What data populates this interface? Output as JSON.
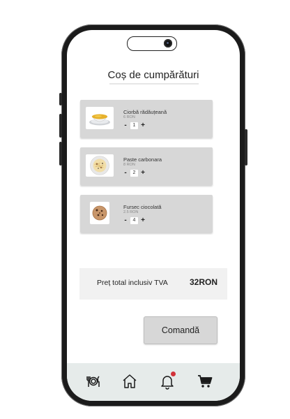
{
  "page": {
    "title": "Coș de cumpărături"
  },
  "cart": {
    "items": [
      {
        "name": "Ciorbă rădăuțeană",
        "price": "6 RON",
        "quantity": "1",
        "icon": "soup-bowl-image"
      },
      {
        "name": "Paste carbonara",
        "price": "8 RON",
        "quantity": "2",
        "icon": "pasta-plate-image"
      },
      {
        "name": "Fursec ciocolată",
        "price": "2.5 RON",
        "quantity": "4",
        "icon": "cookie-image"
      }
    ],
    "decrement_label": "-",
    "increment_label": "+"
  },
  "total": {
    "label": "Preț total inclusiv TVA",
    "value": "32RON"
  },
  "order_button": {
    "label": "Comandă"
  },
  "bottom_nav": {
    "items": [
      "menu-utensils-icon",
      "home-icon",
      "notifications-bell-icon",
      "cart-icon"
    ],
    "notification_badge_color": "#d2323a"
  },
  "colors": {
    "card_bg": "#d7d7d7",
    "nav_bg": "#e6ebea",
    "total_band_bg": "#f1f1f1"
  }
}
